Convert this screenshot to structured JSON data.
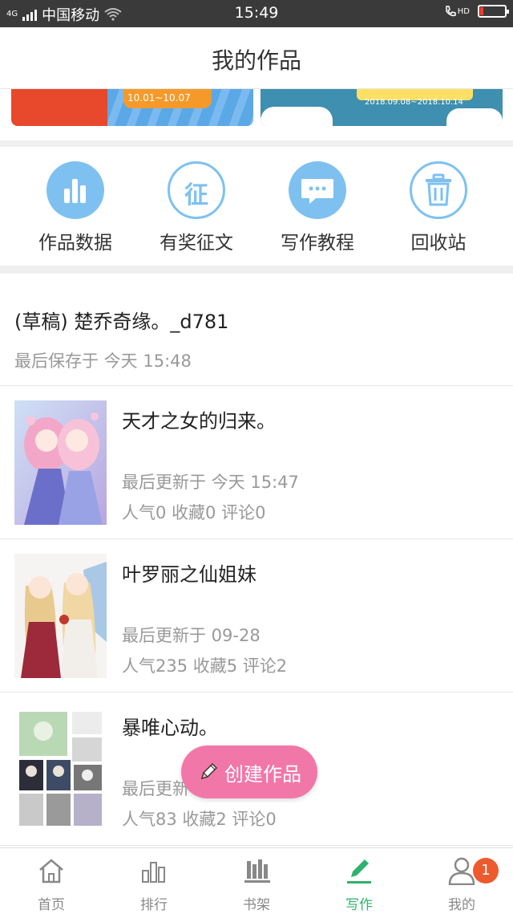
{
  "status_bar": {
    "network": "4G",
    "carrier": "中国移动",
    "time": "15:49",
    "hd_label": "HD",
    "battery_level": 0.12
  },
  "header": {
    "title": "我的作品"
  },
  "banners": [
    {
      "text": "10.01~10.07"
    },
    {
      "text": "2018.09.08~2018.10.14"
    }
  ],
  "tools": [
    {
      "label": "作品数据",
      "icon": "bar-chart-icon"
    },
    {
      "label": "有奖征文",
      "icon": "zheng-character-icon",
      "glyph": "征"
    },
    {
      "label": "写作教程",
      "icon": "chat-bubble-icon",
      "glyph": "···"
    },
    {
      "label": "回收站",
      "icon": "trash-icon"
    }
  ],
  "draft": {
    "title": "(草稿) 楚乔奇缘。_d781",
    "saved": "最后保存于 今天 15:48"
  },
  "works": [
    {
      "title": "天才之女的归来。",
      "updated": "最后更新于 今天 15:47",
      "stats": "人气0 收藏0 评论0"
    },
    {
      "title": "叶罗丽之仙姐妹",
      "updated": "最后更新于 09-28",
      "stats": "人气235 收藏5 评论2"
    },
    {
      "title": "暴唯心动。",
      "updated": "最后更新",
      "stats": "人气83 收藏2 评论0"
    }
  ],
  "fab": {
    "label": "创建作品"
  },
  "tabbar": {
    "items": [
      {
        "label": "首页",
        "icon": "home-icon"
      },
      {
        "label": "排行",
        "icon": "ranking-icon"
      },
      {
        "label": "书架",
        "icon": "bookshelf-icon"
      },
      {
        "label": "写作",
        "icon": "pen-icon",
        "active": true
      },
      {
        "label": "我的",
        "icon": "user-icon"
      }
    ],
    "badge": "1"
  },
  "colors": {
    "accent_green": "#2fb36c",
    "tool_blue": "#7ec1f0",
    "fab_pink": "#f277a9",
    "badge_orange": "#ec5a2e"
  }
}
